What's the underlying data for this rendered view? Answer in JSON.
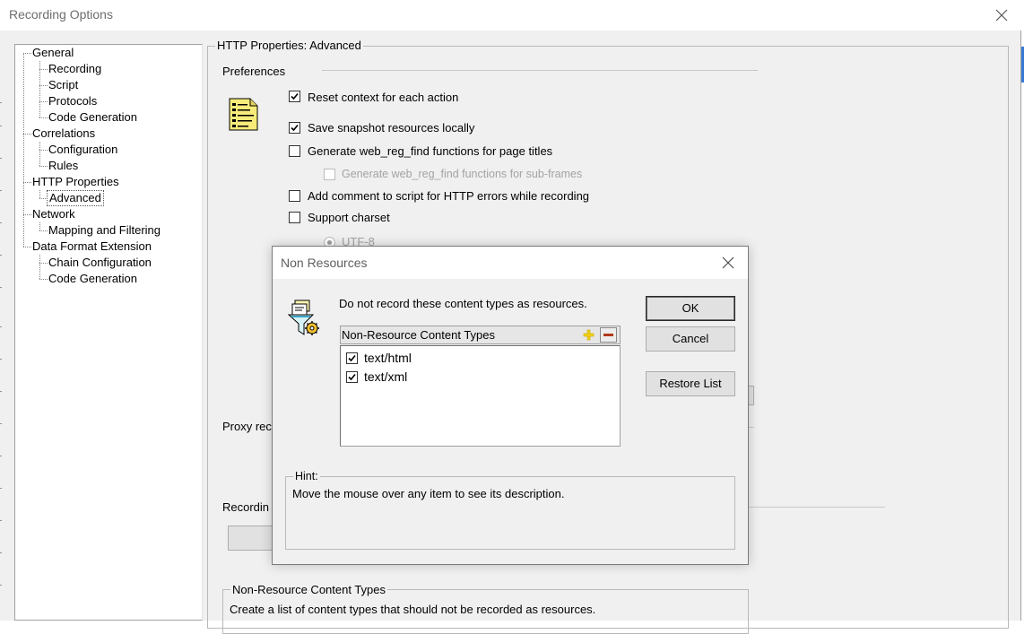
{
  "window": {
    "title": "Recording Options"
  },
  "tree": {
    "items": [
      {
        "label": "General"
      },
      {
        "label": "Recording"
      },
      {
        "label": "Script"
      },
      {
        "label": "Protocols"
      },
      {
        "label": "Code Generation"
      },
      {
        "label": "Correlations"
      },
      {
        "label": "Configuration"
      },
      {
        "label": "Rules"
      },
      {
        "label": "HTTP Properties"
      },
      {
        "label": "Advanced"
      },
      {
        "label": "Network"
      },
      {
        "label": "Mapping and Filtering"
      },
      {
        "label": "Data Format Extension"
      },
      {
        "label": "Chain Configuration"
      },
      {
        "label": "Code Generation"
      }
    ],
    "selected": "Advanced"
  },
  "panel": {
    "group_title": "HTTP Properties: Advanced",
    "preferences_title": "Preferences",
    "options": [
      {
        "label": "Reset context for each action",
        "checked": true
      },
      {
        "label": "Save snapshot resources locally",
        "checked": true
      },
      {
        "label": "Generate web_reg_find functions for page titles",
        "checked": false
      },
      {
        "label": "Generate web_reg_find functions for sub-frames",
        "checked": false,
        "disabled": true
      },
      {
        "label": "Add comment to script for HTTP errors while recording",
        "checked": false
      },
      {
        "label": "Support charset",
        "checked": false
      }
    ],
    "charset_radio": "UTF-8",
    "proxy_label_partial": "Proxy rec",
    "recording_label_partial": "Recordin",
    "bottom_group": {
      "title": "Non-Resource Content Types",
      "description": "Create a list of content types that should not be recorded as resources."
    }
  },
  "dialog": {
    "title": "Non Resources",
    "instruction": "Do not record these content types as resources.",
    "list_header": "Non-Resource Content Types",
    "items": [
      {
        "label": "text/html",
        "checked": true
      },
      {
        "label": "text/xml",
        "checked": true
      }
    ],
    "buttons": {
      "ok": "OK",
      "cancel": "Cancel",
      "restore": "Restore List"
    },
    "hint": {
      "title": "Hint:",
      "text": "Move the mouse over any item to see its description."
    }
  },
  "colors": {
    "window_bg": "#f0f0f0",
    "accent": "#3b7bd6",
    "add_icon": "#f4d21a",
    "remove_icon": "#b33a1a"
  },
  "icons": {
    "close": "close-icon",
    "document": "document-list-icon",
    "filter": "funnel-gear-icon",
    "add": "plus-icon",
    "remove": "minus-icon"
  }
}
